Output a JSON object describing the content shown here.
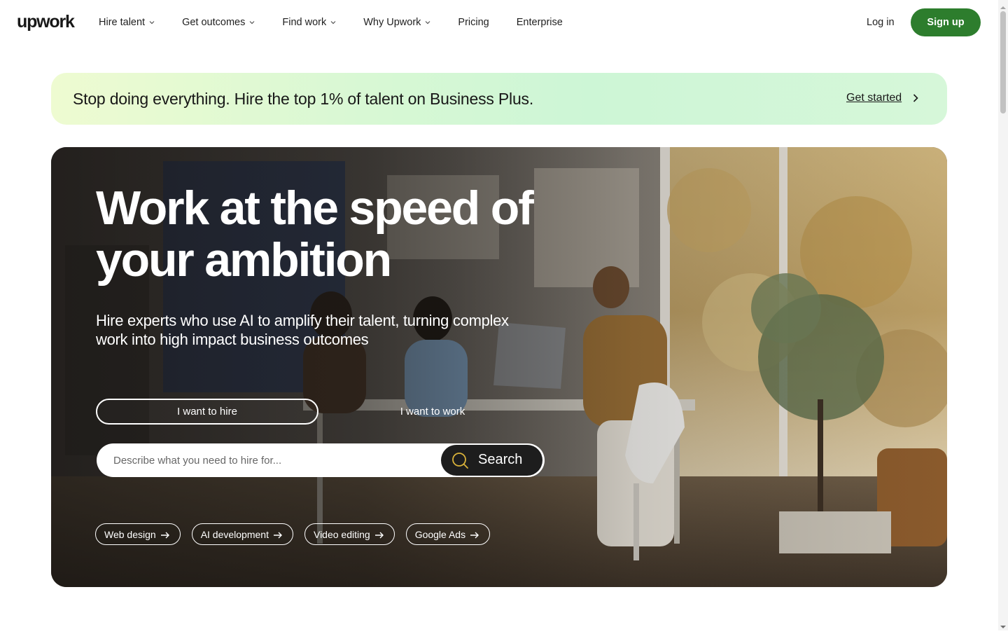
{
  "header": {
    "logo": "upwork",
    "nav": [
      {
        "label": "Hire talent",
        "has_dropdown": true
      },
      {
        "label": "Get outcomes",
        "has_dropdown": true
      },
      {
        "label": "Find work",
        "has_dropdown": true
      },
      {
        "label": "Why Upwork",
        "has_dropdown": true
      },
      {
        "label": "Pricing",
        "has_dropdown": false
      },
      {
        "label": "Enterprise",
        "has_dropdown": false
      }
    ],
    "login_label": "Log in",
    "signup_label": "Sign up"
  },
  "promo": {
    "text": "Stop doing everything. Hire the top 1% of talent on Business Plus.",
    "link_label": "Get started"
  },
  "hero": {
    "title": "Work at the speed of your ambition",
    "subtitle": "Hire experts who use AI to amplify their talent, turning complex work into high impact business outcomes",
    "toggle": {
      "hire_label": "I want to hire",
      "work_label": "I want to work",
      "selected": "hire"
    },
    "search": {
      "placeholder": "Describe what you need to hire for...",
      "button_label": "Search"
    },
    "chips": [
      "Web design",
      "AI development",
      "Video editing",
      "Google Ads"
    ]
  },
  "colors": {
    "brand_green": "#2d7d2d",
    "promo_bg_start": "#eefbd1",
    "promo_bg_end": "#cdf6d6",
    "search_button": "#1d1d1d",
    "text": "#181818"
  },
  "icons": {
    "nav_dropdown": "chevron-down-icon",
    "promo_link": "chevron-right-icon",
    "search": "search-icon",
    "chip": "arrow-right-icon"
  }
}
